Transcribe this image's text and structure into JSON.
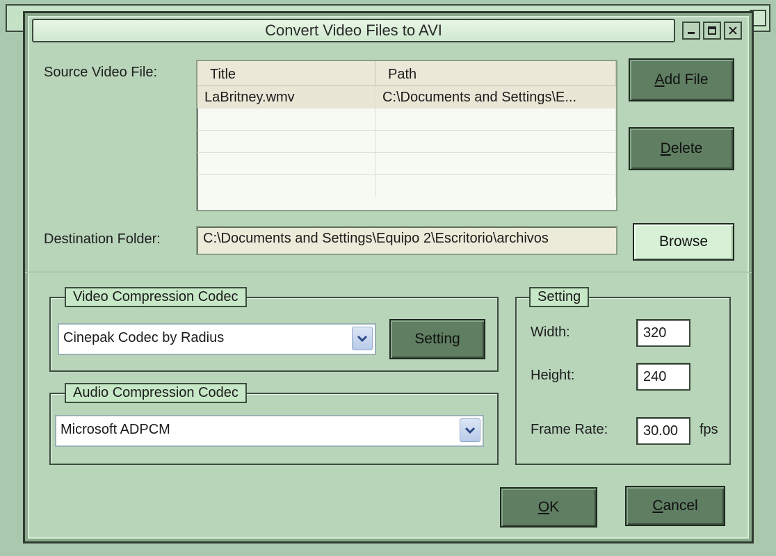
{
  "window": {
    "title": "Convert Video Files to AVI",
    "controls": [
      "minimize-icon",
      "maximize-icon",
      "close-icon"
    ]
  },
  "source": {
    "label": "Source Video File:",
    "columns": [
      "Title",
      "Path"
    ],
    "rows": [
      {
        "title": "LaBritney.wmv",
        "path": "C:\\Documents and Settings\\E..."
      }
    ],
    "add_file": {
      "prefix": "",
      "hot": "A",
      "rest": "dd File"
    },
    "delete": {
      "prefix": "",
      "hot": "D",
      "rest": "elete"
    }
  },
  "destination": {
    "label": "Destination Folder:",
    "value": "C:\\Documents and Settings\\Equipo 2\\Escritorio\\archivos",
    "browse": "Browse"
  },
  "video_codec": {
    "group_title": "Video Compression Codec",
    "selected": "Cinepak Codec by Radius",
    "setting_button": "Setting"
  },
  "audio_codec": {
    "group_title": "Audio Compression Codec",
    "selected": "Microsoft ADPCM"
  },
  "settings": {
    "group_title": "Setting",
    "width_label": "Width:",
    "width_value": "320",
    "height_label": "Height:",
    "height_value": "240",
    "frame_rate_label": "Frame Rate:",
    "frame_rate_value": "30.00",
    "frame_rate_unit": "fps"
  },
  "footer": {
    "ok": {
      "hot": "O",
      "rest": "K"
    },
    "cancel": {
      "hot": "C",
      "rest": "ancel"
    }
  },
  "colors": {
    "dialog_bg": "#b8d5ba",
    "button_dark": "#5f7e62",
    "button_light": "#d7f1d6",
    "group_title_bg": "#c7e8c7"
  }
}
